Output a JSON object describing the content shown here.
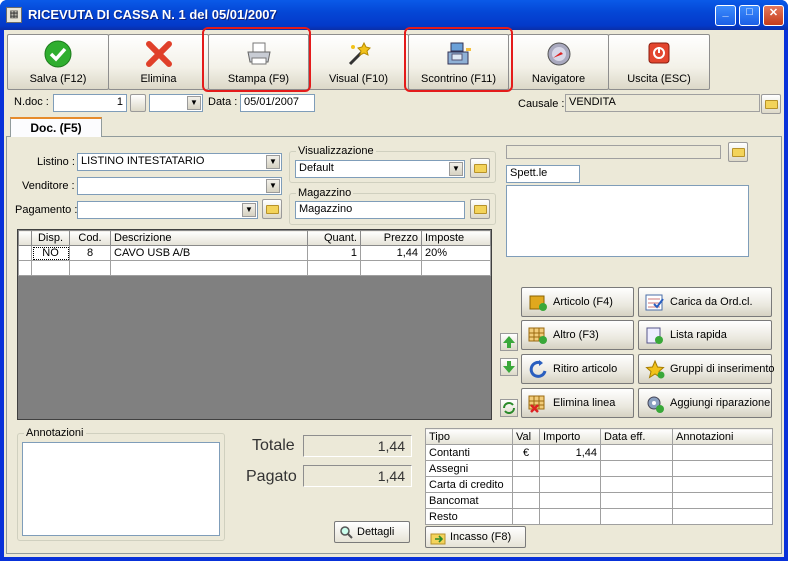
{
  "window": {
    "title": "RICEVUTA DI CASSA N. 1  del 05/01/2007"
  },
  "toolbar": [
    {
      "label": "Salva (F12)",
      "icon": "check-icon"
    },
    {
      "label": "Elimina",
      "icon": "x-icon"
    },
    {
      "label": "Stampa (F9)",
      "icon": "printer-icon"
    },
    {
      "label": "Visual (F10)",
      "icon": "magic-wand-icon"
    },
    {
      "label": "Scontrino (F11)",
      "icon": "cash-register-icon"
    },
    {
      "label": "Navigatore",
      "icon": "compass-icon"
    },
    {
      "label": "Uscita (ESC)",
      "icon": "exit-icon"
    }
  ],
  "header": {
    "ndoc_label": "N.doc :",
    "ndoc_value": "1",
    "data_label": "Data :",
    "data_value": "05/01/2007",
    "causale_label": "Causale :",
    "causale_value": "VENDITA"
  },
  "tab": {
    "label": "Doc. (F5)"
  },
  "form": {
    "listino_label": "Listino :",
    "listino_value": "LISTINO INTESTATARIO",
    "venditore_label": "Venditore :",
    "venditore_value": "",
    "pagamento_label": "Pagamento :",
    "pagamento_value": ""
  },
  "visualizzazione": {
    "title": "Visualizzazione",
    "value": "Default"
  },
  "magazzino": {
    "title": "Magazzino",
    "value": "Magazzino"
  },
  "customer": {
    "name_value": "",
    "spett_value": "Spett.le"
  },
  "grid": {
    "columns": [
      "Disp.",
      "Cod.",
      "Descrizione",
      "Quant.",
      "Prezzo",
      "Imposte"
    ],
    "rows": [
      [
        "NO",
        "8",
        "CAVO USB A/B",
        "1",
        "1,44",
        "20%"
      ]
    ]
  },
  "actions": {
    "articolo": "Articolo (F4)",
    "carica": "Carica da Ord.cl.",
    "altro": "Altro (F3)",
    "lista": "Lista rapida",
    "ritiro": "Ritiro articolo",
    "gruppi": "Gruppi di inserimento",
    "elimina": "Elimina linea",
    "riparazione": "Aggiungi riparazione"
  },
  "annotazioni": {
    "title": "Annotazioni"
  },
  "totals": {
    "totale_label": "Totale",
    "totale_value": "1,44",
    "pagato_label": "Pagato",
    "pagato_value": "1,44",
    "dettagli_label": "Dettagli"
  },
  "payments": {
    "columns": [
      "Tipo",
      "Val",
      "Importo",
      "Data eff.",
      "Annotazioni"
    ],
    "rows": [
      {
        "tipo": "Contanti",
        "val": "€",
        "importo": "1,44"
      },
      {
        "tipo": "Assegni",
        "val": "",
        "importo": ""
      },
      {
        "tipo": "Carta di credito",
        "val": "",
        "importo": ""
      },
      {
        "tipo": "Bancomat",
        "val": "",
        "importo": ""
      },
      {
        "tipo": "Resto",
        "val": "",
        "importo": ""
      }
    ],
    "incasso_label": "Incasso (F8)"
  },
  "colors": {
    "title_bar": "#0447d6",
    "highlight": "#e41b1b",
    "window_bg": "#ece9d8"
  }
}
